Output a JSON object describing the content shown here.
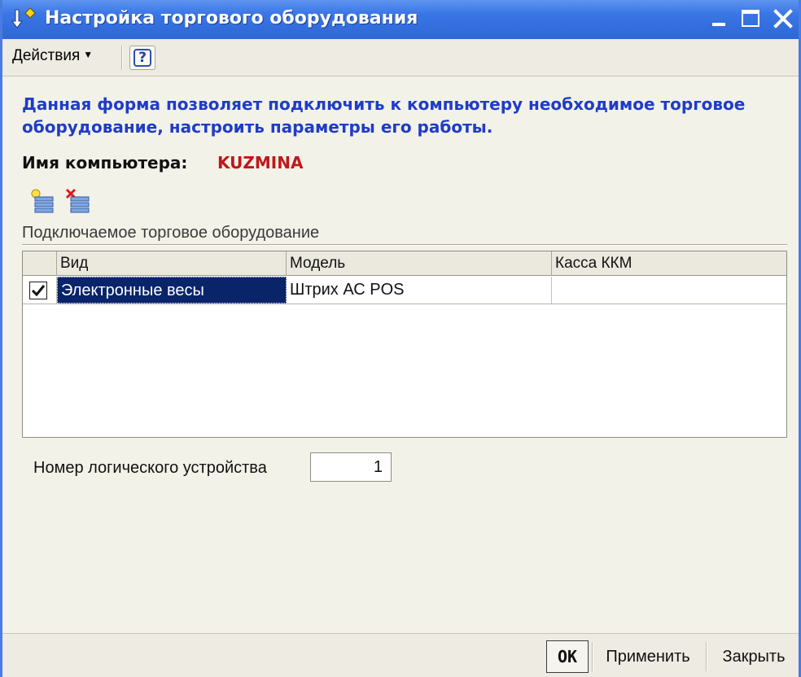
{
  "window": {
    "title": "Настройка торгового оборудования",
    "colors": {
      "titlebar": "#2f67d6",
      "info_text": "#1f3cc8",
      "computer_name": "#c0171b",
      "selection": "#0a246a"
    }
  },
  "toolbar": {
    "actions_label": "Действия",
    "help_label": "?"
  },
  "form": {
    "info_text": "Данная форма позволяет подключить к компьютеру необходимое торговое оборудование, настроить параметры его работы.",
    "computer_label": "Имя компьютера:",
    "computer_value": "KUZMINA",
    "icons": [
      "add-equipment-icon",
      "delete-equipment-icon"
    ]
  },
  "equipment": {
    "caption": "Подключаемое торговое оборудование",
    "columns": {
      "vid": "Вид",
      "model": "Модель",
      "kassa": "Касса ККМ"
    },
    "rows": [
      {
        "checked": true,
        "vid": "Электронные весы",
        "model": "Штрих АС POS",
        "kassa": ""
      }
    ]
  },
  "logical_device": {
    "label": "Номер логического устройства",
    "value": "1"
  },
  "footer": {
    "ok_label": "OK",
    "apply_label": "Применить",
    "close_label": "Закрыть"
  }
}
